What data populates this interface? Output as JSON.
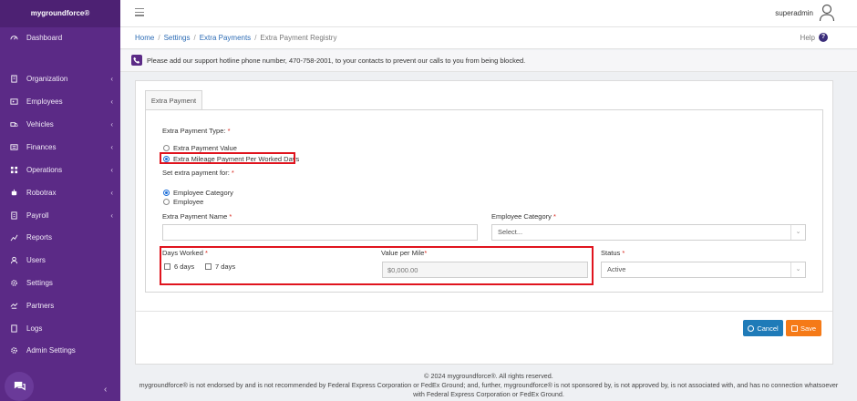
{
  "brand": "mygroundforce®",
  "sidebar": {
    "items": [
      {
        "label": "Dashboard",
        "icon": "dashboard-icon",
        "chevron": false
      },
      {
        "label": "Organization",
        "icon": "building-icon",
        "chevron": true
      },
      {
        "label": "Employees",
        "icon": "employees-icon",
        "chevron": true
      },
      {
        "label": "Vehicles",
        "icon": "truck-icon",
        "chevron": true
      },
      {
        "label": "Finances",
        "icon": "finances-icon",
        "chevron": true
      },
      {
        "label": "Operations",
        "icon": "operations-icon",
        "chevron": true
      },
      {
        "label": "Robotrax",
        "icon": "robot-icon",
        "chevron": true
      },
      {
        "label": "Payroll",
        "icon": "payroll-icon",
        "chevron": true
      },
      {
        "label": "Reports",
        "icon": "reports-icon",
        "chevron": false
      },
      {
        "label": "Users",
        "icon": "users-icon",
        "chevron": false
      },
      {
        "label": "Settings",
        "icon": "gear-icon",
        "chevron": false
      },
      {
        "label": "Partners",
        "icon": "partners-icon",
        "chevron": false
      },
      {
        "label": "Logs",
        "icon": "logs-icon",
        "chevron": false
      },
      {
        "label": "Admin Settings",
        "icon": "admin-gear-icon",
        "chevron": false
      }
    ],
    "chevron": "‹",
    "collapse": "‹"
  },
  "topbar": {
    "user": "superadmin"
  },
  "breadcrumb": {
    "home": "Home",
    "settings": "Settings",
    "extra_payments": "Extra Payments",
    "current": "Extra Payment Registry",
    "sep": "/",
    "help": "Help",
    "help_icon": "?"
  },
  "notice": {
    "text": "Please add our support hotline phone number, 470-758-2001, to your contacts to prevent our calls to you from being blocked."
  },
  "form": {
    "tab": "Extra Payment",
    "type_label": "Extra Payment Type:",
    "type_options": [
      "Extra Payment Value",
      "Extra Mileage Payment Per Worked Days"
    ],
    "type_selected": 1,
    "for_label": "Set extra payment for:",
    "for_options": [
      "Employee Category",
      "Employee"
    ],
    "for_selected": 0,
    "name_label": "Extra Payment Name",
    "name_value": "",
    "category_label": "Employee Category",
    "category_placeholder": "Select...",
    "days_label": "Days Worked",
    "days_options": [
      "6 days",
      "7 days"
    ],
    "value_label": "Value per Mile",
    "value_placeholder": "$0,000.00",
    "status_label": "Status",
    "status_value": "Active",
    "required_mark": "*",
    "caret": "⌄"
  },
  "actions": {
    "cancel": "Cancel",
    "save": "Save"
  },
  "footer": {
    "line1": "© 2024 mygroundforce®. All rights reserved.",
    "line2": "mygroundforce® is not endorsed by and is not recommended by Federal Express Corporation or FedEx Ground; and, further, mygroundforce® is not sponsored by, is not approved by, is not associated with, and has no connection whatsoever",
    "line3": "with Federal Express Corporation or FedEx Ground."
  },
  "colors": {
    "sidebar": "#5b2a86",
    "highlight": "#e0141e",
    "cancel": "#1f7bb8",
    "save": "#f57a17"
  }
}
